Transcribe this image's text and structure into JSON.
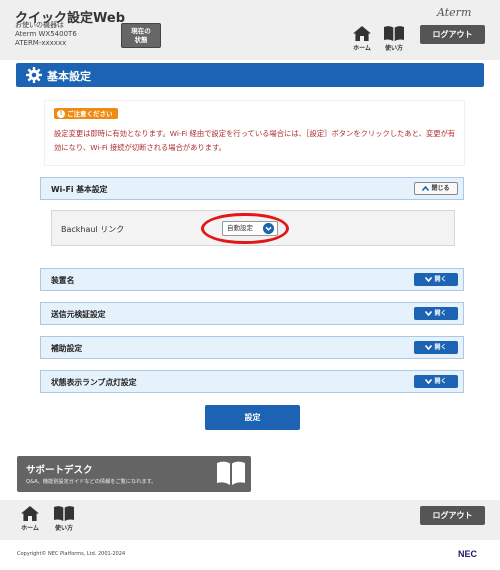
{
  "header": {
    "app_title": "クイック設定Web",
    "device_heading": "お使いの機器は",
    "device_model": "Aterm WX5400T6",
    "device_id": "ATERM-xxxxxx",
    "status_button": [
      "現在の",
      "状態"
    ],
    "logo": "Aterm",
    "home_label": "ホーム",
    "help_label": "使い方",
    "logout_label": "ログアウト"
  },
  "page": {
    "title": "基本設定"
  },
  "notice": {
    "badge": "ご注意ください",
    "text": "設定変更は即時に有効となります。Wi-Fi 経由で設定を行っている場合には、［設定］ボタンをクリックしたあと、変更が有効になり、Wi-Fi 接続が切断される場合があります。"
  },
  "sections": {
    "wifi_basic": {
      "label": "Wi-Fi 基本設定",
      "button": "閉じる"
    },
    "backhaul": {
      "label": "Backhaul リンク",
      "value": "自動設定"
    },
    "device_name": {
      "label": "装置名",
      "button": "開く"
    },
    "source_verify": {
      "label": "送信元検証設定",
      "button": "開く"
    },
    "assist": {
      "label": "補助設定",
      "button": "開く"
    },
    "status_lamp": {
      "label": "状態表示ランプ点灯設定",
      "button": "開く"
    }
  },
  "apply_button": "設定",
  "support": {
    "title": "サポートデスク",
    "description": "Q&A、機能別設定ガイドなどの情報をご覧になれます。"
  },
  "footer": {
    "home_label": "ホーム",
    "help_label": "使い方",
    "logout_label": "ログアウト",
    "copyright": "Copyright© NEC Platforms, Ltd. 2001-2024",
    "vendor_logo": "NEC"
  },
  "colors": {
    "primary_blue": "#1c64b3",
    "notice_orange": "#ef8a12",
    "notice_text_red": "#b02c2c",
    "highlight_red": "#e21818",
    "section_bg": "#e5f1fb"
  },
  "icons": [
    "gear-icon",
    "home-icon",
    "book-icon",
    "chevron-up-icon",
    "chevron-down-icon",
    "info-icon"
  ]
}
